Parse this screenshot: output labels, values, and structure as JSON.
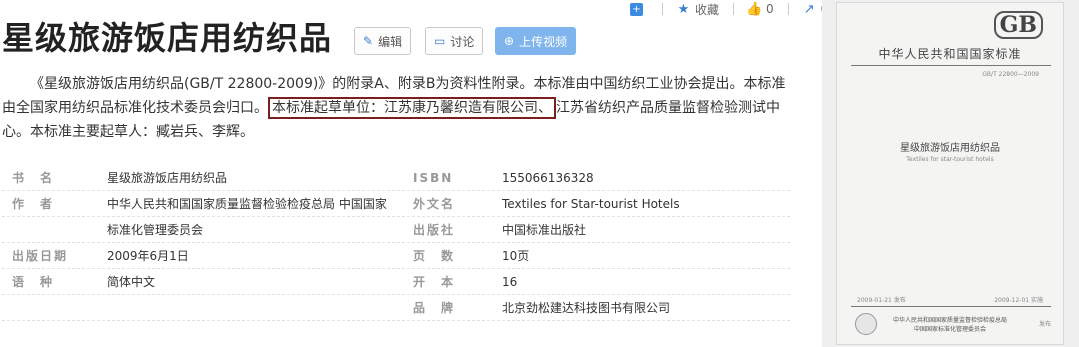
{
  "toolbar": {
    "collect_label": "收藏",
    "like_count": "0",
    "share_count": "0"
  },
  "title": "星级旅游饭店用纺织品",
  "buttons": {
    "edit": "编辑",
    "discuss": "讨论",
    "upload": "上传视频"
  },
  "description": {
    "before": "《星级旅游饭店用纺织品(GB/T 22800-2009)》的附录A、附录B为资料性附录。本标准由中国纺织工业协会提出。本标准由全国家用纺织品标准化技术委员会归口。",
    "highlight": "本标准起草单位：江苏康乃馨织造有限公司、",
    "after": "江苏省纺织产品质量监督检验测试中心。本标准主要起草人：臧岩兵、李辉。"
  },
  "info_rows": [
    {
      "l1": "书　名",
      "v1": "星级旅游饭店用纺织品",
      "l2": "ISBN",
      "v2": "155066136328"
    },
    {
      "l1": "作　者",
      "v1": "中华人民共和国国家质量监督检验检疫总局 中国国家",
      "l2": "外文名",
      "v2": "Textiles for Star-tourist Hotels"
    },
    {
      "l1": "",
      "v1": "标准化管理委员会",
      "l2": "出版社",
      "v2": "中国标准出版社"
    },
    {
      "l1": "出版日期",
      "v1": "2009年6月1日",
      "l2": "页　数",
      "v2": "10页"
    },
    {
      "l1": "语　种",
      "v1": "简体中文",
      "l2": "开　本",
      "v2": "16"
    },
    {
      "l1": "",
      "v1": "",
      "l2": "品　牌",
      "v2": "北京劲松建达科技图书有限公司"
    }
  ],
  "cover": {
    "gb_logo": "GB",
    "header": "中华人民共和国国家标准",
    "code": "GB/T 22800—2009",
    "title": "星级旅游饭店用纺织品",
    "subtitle": "Textiles for star-tourist hotels",
    "issue_date": "2009-01-21 发布",
    "impl_date": "2009-12-01 实施",
    "issuer1": "中华人民共和国国家质量监督检验检疫总局",
    "issuer2": "中国国家标准化管理委员会",
    "issue_word": "发布"
  }
}
